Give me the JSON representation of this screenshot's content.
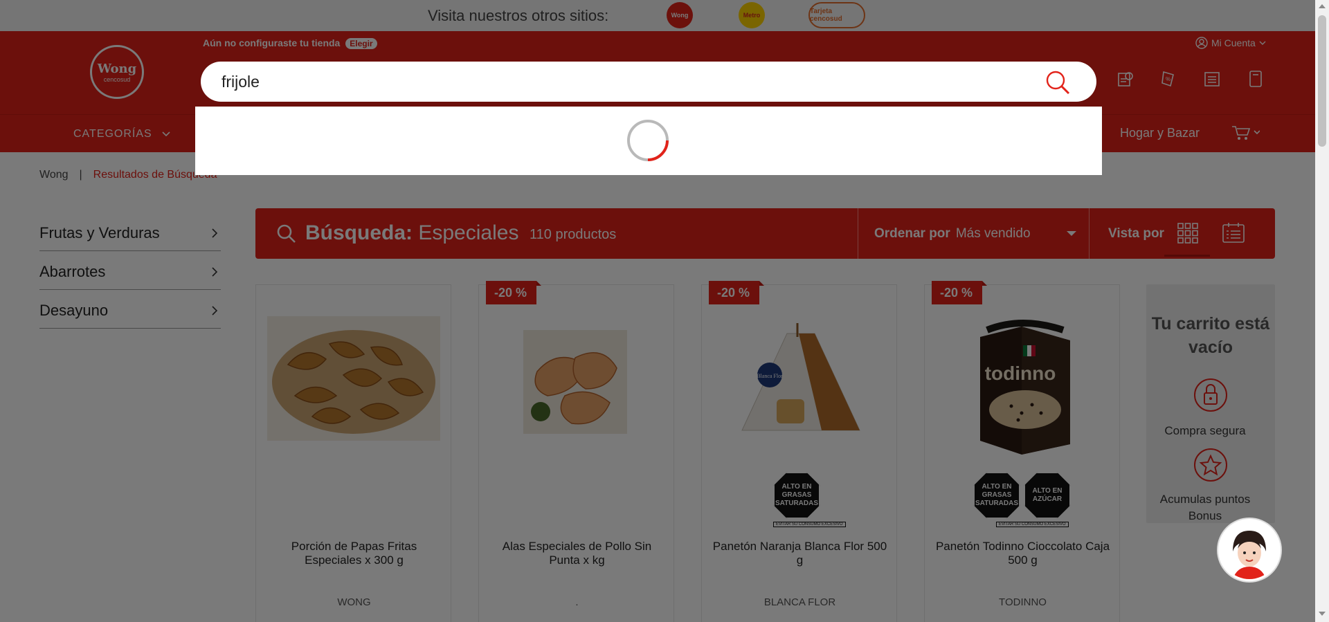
{
  "topbar": {
    "text": "Visita nuestros otros sitios:",
    "sites": [
      "Wong",
      "Metro",
      "Tarjeta cencosud"
    ]
  },
  "header": {
    "logo_main": "Wong",
    "logo_sub": "cencosud",
    "store_msg": "Aún no configuraste tu tienda",
    "store_btn": "Elegir",
    "account": "Mi Cuenta",
    "search_value": "frijole",
    "icons": [
      "tracking-icon",
      "offers-icon",
      "list-icon",
      "catalog-icon"
    ]
  },
  "nav": {
    "categories": "CATEGORÍAS",
    "hogar": "Hogar y Bazar"
  },
  "breadcrumb": {
    "home": "Wong",
    "sep": "|",
    "current": "Resultados de Búsqueda"
  },
  "sidebar": {
    "items": [
      {
        "label": "Frutas y Verduras"
      },
      {
        "label": "Abarrotes"
      },
      {
        "label": "Desayuno"
      }
    ]
  },
  "results": {
    "search_label": "Búsqueda:",
    "term": "Especiales",
    "count": "110 productos",
    "order_label": "Ordenar por",
    "order_value": "Más vendido",
    "view_label": "Vista por"
  },
  "products": [
    {
      "name": "Porción de Papas Fritas Especiales x 300 g",
      "brand": "WONG",
      "discount": ""
    },
    {
      "name": "Alas Especiales de Pollo Sin Punta x kg",
      "brand": ".",
      "discount": "-20 %"
    },
    {
      "name": "Panetón Naranja Blanca Flor 500 g",
      "brand": "BLANCA FLOR",
      "discount": "-20 %",
      "warnings": [
        "ALTO EN GRASAS SATURADAS"
      ],
      "warn_note": "EVITAR SU CONSUMO EXCESIVO",
      "package_text": "Blanca Flor"
    },
    {
      "name": "Panetón Todinno Cioccolato Caja 500 g",
      "brand": "TODINNO",
      "discount": "-20 %",
      "warnings": [
        "ALTO EN GRASAS SATURADAS",
        "ALTO EN AZÚCAR"
      ],
      "warn_note": "EVITAR SU CONSUMO EXCESIVO",
      "package_text": "todinno"
    }
  ],
  "minicart": {
    "title": "Tu carrito está vacío",
    "secure": "Compra segura",
    "bonus": "Acumulas puntos Bonus"
  },
  "colors": {
    "brand_red": "#e2231a",
    "overlay": "rgba(0,0,0,0.52)"
  }
}
